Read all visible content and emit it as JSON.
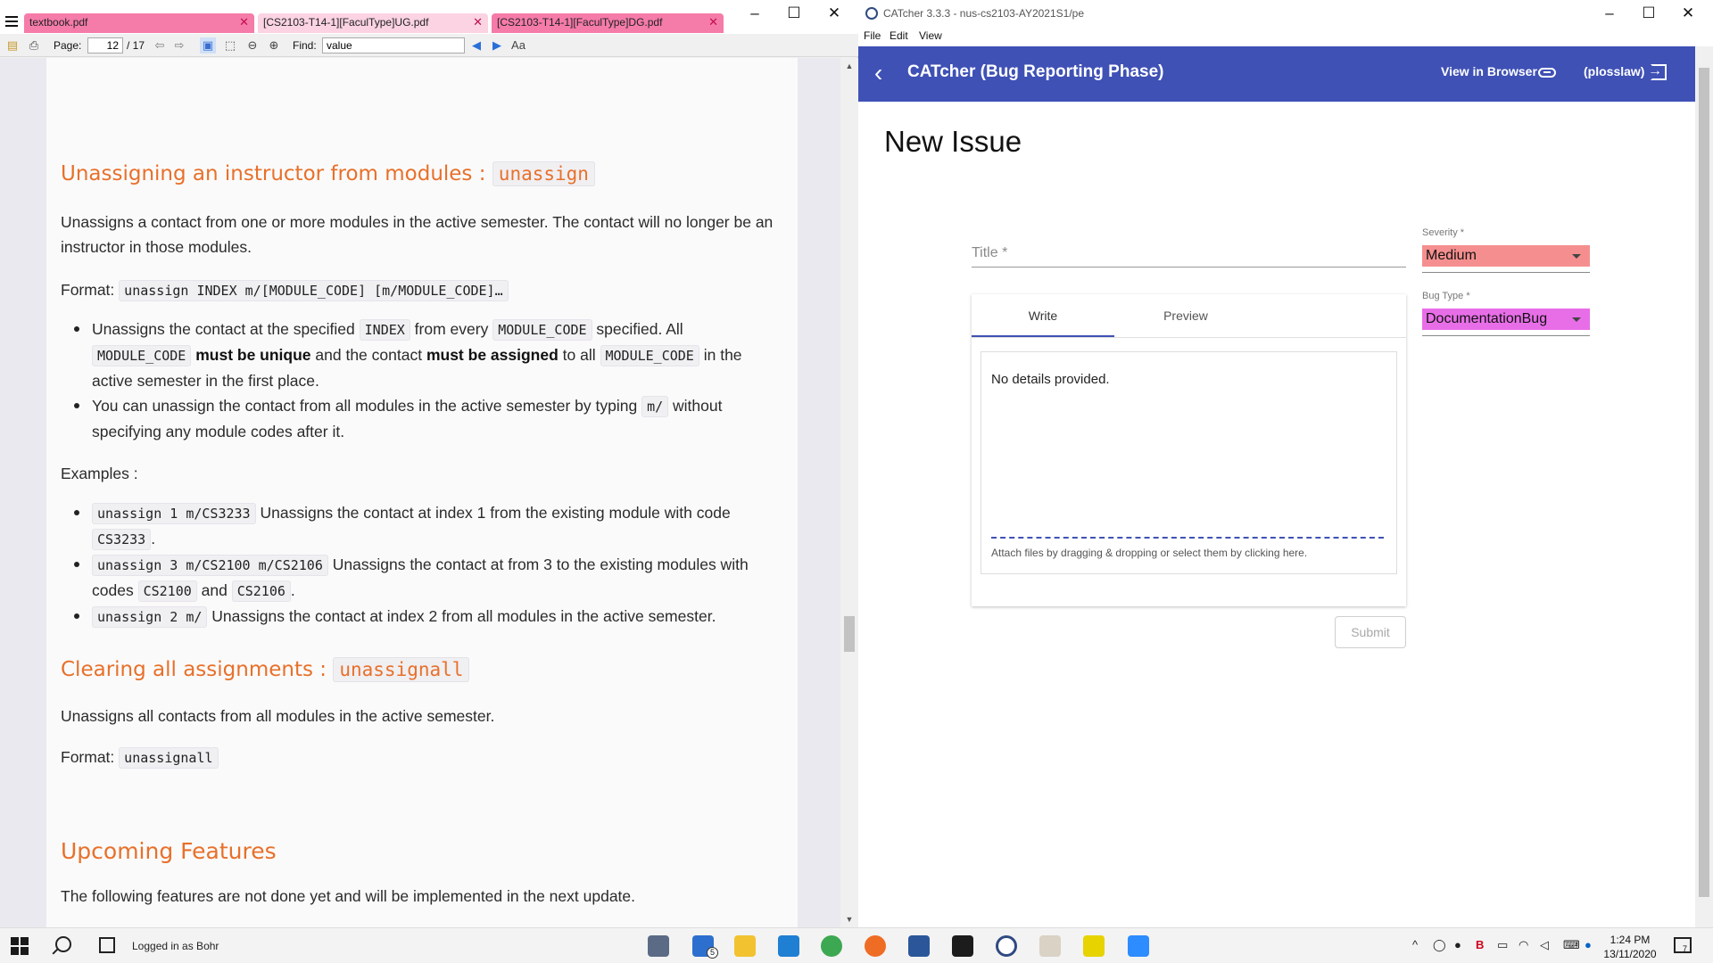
{
  "pdf": {
    "tabs": [
      {
        "label": "textbook.pdf",
        "active": true
      },
      {
        "label": "[CS2103-T14-1][FaculType]UG.pdf",
        "active": false
      },
      {
        "label": "[CS2103-T14-1][FaculType]DG.pdf",
        "active": true
      }
    ],
    "toolbar": {
      "page_label": "Page:",
      "page_value": "12",
      "page_total": "/ 17",
      "find_label": "Find:",
      "find_value": "value"
    },
    "doc": {
      "unassign": {
        "heading_text": "Unassigning an instructor from modules :",
        "heading_code": "unassign",
        "intro": "Unassigns a contact from one or more modules in the active semester. The contact will no longer be an instructor in those modules.",
        "format_label": "Format:",
        "format_code": "unassign INDEX m/[MODULE_CODE] [m/MODULE_CODE]…",
        "bullet1": {
          "t1": "Unassigns the contact at the specified",
          "c1": "INDEX",
          "t2": "from every",
          "c2": "MODULE_CODE",
          "t3": "specified. All",
          "c3": "MODULE_CODE",
          "b1": "must be unique",
          "t4": "and the contact",
          "b2": "must be assigned",
          "t5": "to all",
          "c4": "MODULE_CODE",
          "t6": "in the active semester in the first place."
        },
        "bullet2": {
          "t1": "You can unassign the contact from all modules in the active semester by typing",
          "c1": "m/",
          "t2": "without specifying any module codes after it."
        },
        "examples_label": "Examples :",
        "example1": {
          "code": "unassign 1 m/CS3233",
          "text": "Unassigns the contact at index 1 from the existing module with code",
          "code2": "CS3233",
          "tail": "."
        },
        "example2": {
          "code": "unassign 3 m/CS2100 m/CS2106",
          "text": "Unassigns the contact at from 3 to the existing modules with codes",
          "code2": "CS2100",
          "and": "and",
          "code3": "CS2106",
          "tail": "."
        },
        "example3": {
          "code": "unassign 2 m/",
          "text": "Unassigns the contact at index 2 from all modules in the active semester."
        }
      },
      "unassignall": {
        "heading_text": "Clearing all assignments :",
        "heading_code": "unassignall",
        "intro": "Unassigns all contacts from all modules in the active semester.",
        "format_label": "Format:",
        "format_code": "unassignall"
      },
      "upcoming": {
        "heading": "Upcoming Features",
        "intro": "The following features are not done yet and will be implemented in the next update."
      }
    }
  },
  "catcher": {
    "window_title": "CATcher 3.3.3 - nus-cs2103-AY2021S1/pe",
    "menu": [
      "File",
      "Edit",
      "View"
    ],
    "header": {
      "title": "CATcher  (Bug Reporting Phase)",
      "view_in_browser": "View in Browser",
      "user": "(plosslaw)"
    },
    "page_title": "New Issue",
    "title_placeholder": "Title *",
    "tabs": [
      "Write",
      "Preview"
    ],
    "editor_text": "No details provided.",
    "dropzone_text": "Attach files by dragging & dropping or select them by clicking here.",
    "submit_label": "Submit",
    "severity": {
      "label": "Severity *",
      "value": "Medium",
      "color": "#f58f8f"
    },
    "bug_type": {
      "label": "Bug Type *",
      "value": "DocumentationBug",
      "color": "#e86ee8"
    }
  },
  "taskbar": {
    "status_text": "Logged in as Bohr",
    "mail_badge": "5",
    "time": "1:24 PM",
    "date": "13/11/2020",
    "notification_count": "7"
  }
}
